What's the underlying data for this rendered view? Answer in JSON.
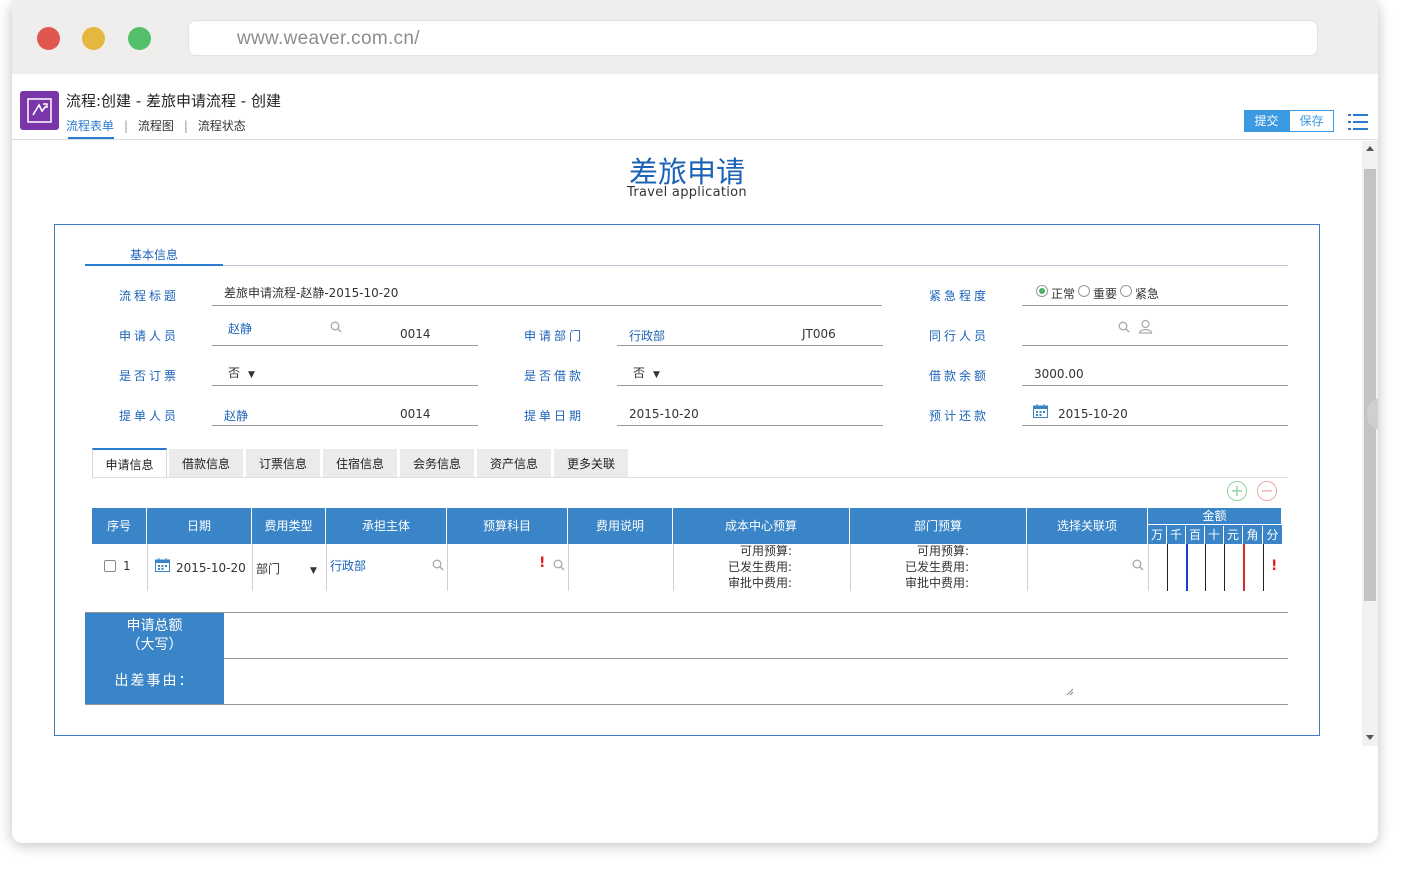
{
  "browser": {
    "url": "www.weaver.com.cn/"
  },
  "app": {
    "title": "流程:创建 - 差旅申请流程 - 创建",
    "tabs": [
      "流程表单",
      "流程图",
      "流程状态"
    ],
    "submit_label": "提交",
    "save_label": "保存"
  },
  "form": {
    "title": "差旅申请",
    "subtitle": "Travel application",
    "section_tab": "基本信息",
    "fields": {
      "flow_title_label": "流程标题",
      "flow_title_value": "差旅申请流程-赵静-2015-10-20",
      "urgency_label": "紧急程度",
      "urgency_options": [
        "正常",
        "重要",
        "紧急"
      ],
      "urgency_selected": "正常",
      "applicant_label": "申请人员",
      "applicant_value": "赵静",
      "applicant_code": "0014",
      "dept_label": "申请部门",
      "dept_value": "行政部",
      "dept_code": "JT006",
      "companion_label": "同行人员",
      "ticket_label": "是否订票",
      "ticket_value": "否",
      "loan_label": "是否借款",
      "loan_value": "否",
      "loan_balance_label": "借款余额",
      "loan_balance_value": "3000.00",
      "submitter_label": "提单人员",
      "submitter_value": "赵静",
      "submitter_code": "0014",
      "submit_date_label": "提单日期",
      "submit_date_value": "2015-10-20",
      "repay_label": "预计还款",
      "repay_value": "2015-10-20"
    },
    "detail_tabs": [
      "申请信息",
      "借款信息",
      "订票信息",
      "住宿信息",
      "会务信息",
      "资产信息",
      "更多关联"
    ],
    "table": {
      "headers": [
        "序号",
        "日期",
        "费用类型",
        "承担主体",
        "预算科目",
        "费用说明",
        "成本中心预算",
        "部门预算",
        "选择关联项"
      ],
      "amount_header": "金额",
      "amount_units": [
        "万",
        "千",
        "百",
        "十",
        "元",
        "角",
        "分"
      ],
      "row": {
        "index": "1",
        "date": "2015-10-20",
        "fee_type": "部门",
        "bearer": "行政部",
        "budget_lines": [
          "可用预算:",
          "已发生费用:",
          "审批中费用:"
        ]
      }
    },
    "total_label_line1": "申请总额",
    "total_label_line2": "（大写）",
    "reason_label": "出差事由："
  }
}
